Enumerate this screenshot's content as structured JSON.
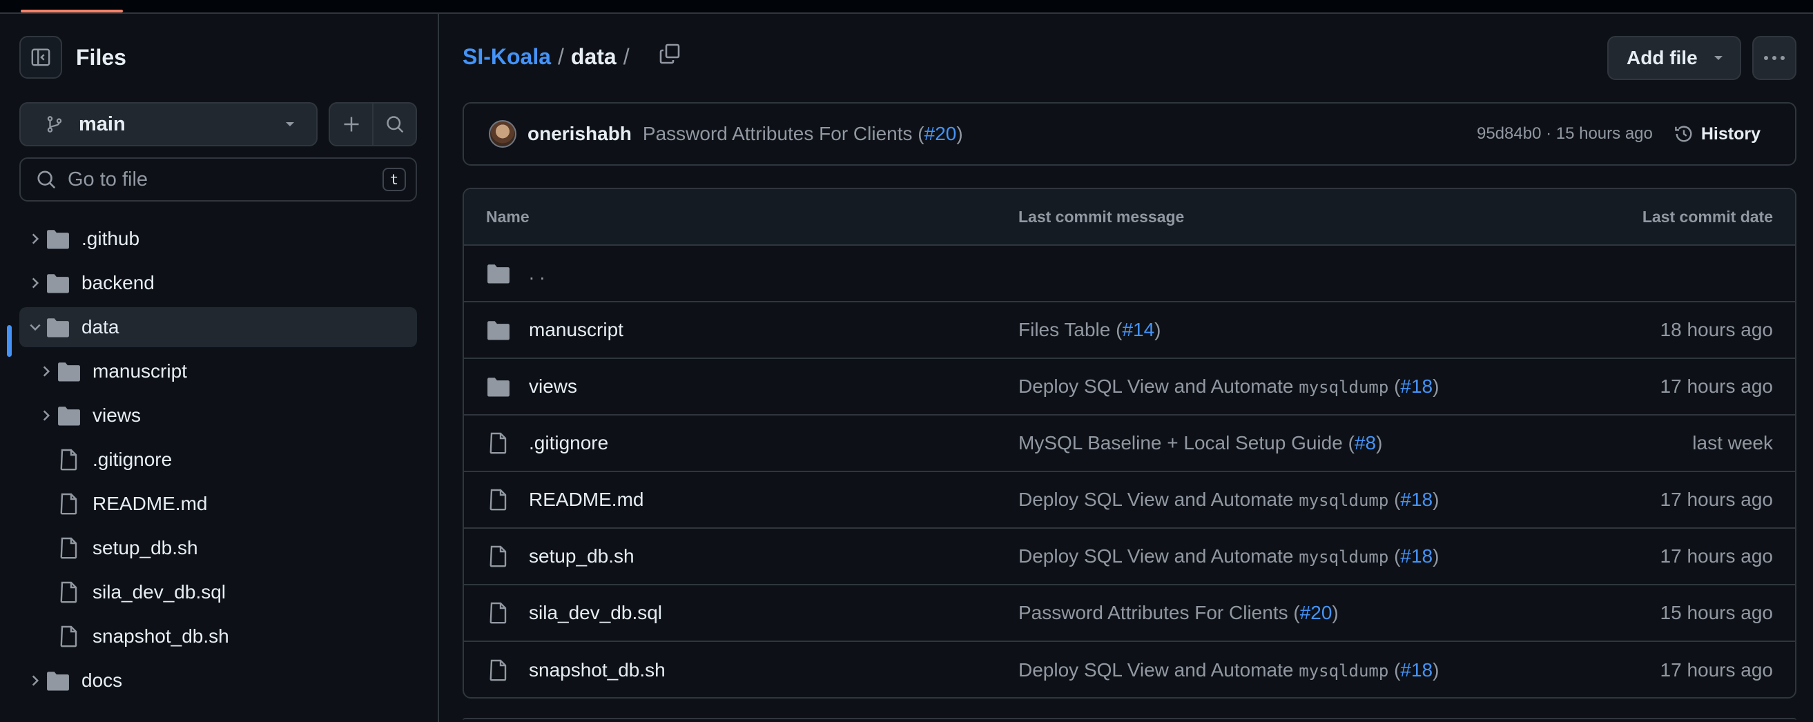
{
  "sidebar": {
    "title": "Files",
    "branch": "main",
    "search_placeholder": "Go to file",
    "search_shortcut": "t",
    "tree": [
      {
        "label": ".github",
        "type": "folder",
        "depth": 0,
        "expanded": false
      },
      {
        "label": "backend",
        "type": "folder",
        "depth": 0,
        "expanded": false
      },
      {
        "label": "data",
        "type": "folder",
        "depth": 0,
        "expanded": true,
        "selected": true
      },
      {
        "label": "manuscript",
        "type": "folder",
        "depth": 1,
        "expanded": false
      },
      {
        "label": "views",
        "type": "folder",
        "depth": 1,
        "expanded": false
      },
      {
        "label": ".gitignore",
        "type": "file",
        "depth": 1
      },
      {
        "label": "README.md",
        "type": "file",
        "depth": 1
      },
      {
        "label": "setup_db.sh",
        "type": "file",
        "depth": 1
      },
      {
        "label": "sila_dev_db.sql",
        "type": "file",
        "depth": 1
      },
      {
        "label": "snapshot_db.sh",
        "type": "file",
        "depth": 1
      },
      {
        "label": "docs",
        "type": "folder",
        "depth": 0,
        "expanded": false
      }
    ]
  },
  "breadcrumb": {
    "repo": "SI-Koala",
    "sep": "/",
    "current": "data",
    "trail_sep": "/"
  },
  "toolbar": {
    "add_file_label": "Add file"
  },
  "commit": {
    "author": "onerishabh",
    "message": "Password Attributes For Clients (",
    "pr": "#20",
    "message_end": ")",
    "sha_time": "95d84b0 · 15 hours ago",
    "history_label": "History"
  },
  "table": {
    "headers": {
      "name": "Name",
      "message": "Last commit message",
      "date": "Last commit date"
    },
    "parent_label": ". .",
    "rows": [
      {
        "name": "manuscript",
        "type": "folder",
        "msg": "Files Table (",
        "code": "",
        "pr": "#14",
        "msg_end": ")",
        "date": "18 hours ago"
      },
      {
        "name": "views",
        "type": "folder",
        "msg": "Deploy SQL View and Automate ",
        "code": "mysqldump",
        "msg_mid": " (",
        "pr": "#18",
        "msg_end": ")",
        "date": "17 hours ago"
      },
      {
        "name": ".gitignore",
        "type": "file",
        "msg": "MySQL Baseline + Local Setup Guide (",
        "code": "",
        "pr": "#8",
        "msg_end": ")",
        "date": "last week"
      },
      {
        "name": "README.md",
        "type": "file",
        "msg": "Deploy SQL View and Automate ",
        "code": "mysqldump",
        "msg_mid": " (",
        "pr": "#18",
        "msg_end": ")",
        "date": "17 hours ago"
      },
      {
        "name": "setup_db.sh",
        "type": "file",
        "msg": "Deploy SQL View and Automate ",
        "code": "mysqldump",
        "msg_mid": " (",
        "pr": "#18",
        "msg_end": ")",
        "date": "17 hours ago"
      },
      {
        "name": "sila_dev_db.sql",
        "type": "file",
        "msg": "Password Attributes For Clients (",
        "code": "",
        "pr": "#20",
        "msg_end": ")",
        "date": "15 hours ago"
      },
      {
        "name": "snapshot_db.sh",
        "type": "file",
        "msg": "Deploy SQL View and Automate ",
        "code": "mysqldump",
        "msg_mid": " (",
        "pr": "#18",
        "msg_end": ")",
        "date": "17 hours ago"
      }
    ]
  }
}
